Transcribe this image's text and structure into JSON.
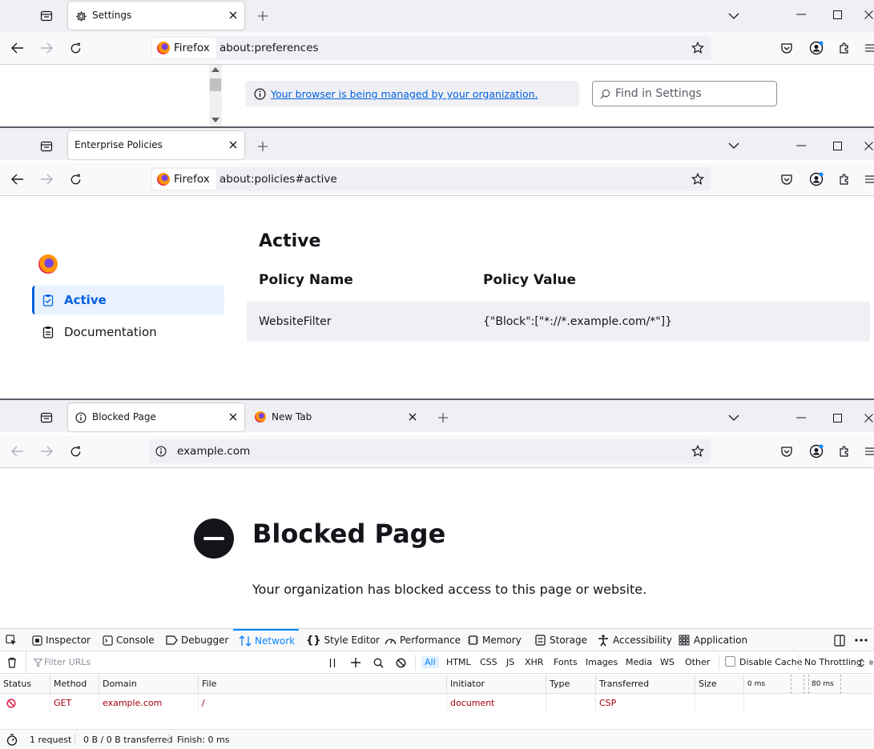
{
  "window1": {
    "tab_title": "Settings",
    "identity_label": "Firefox",
    "url": "about:preferences",
    "managed_notice": "Your browser is being managed by your organization.",
    "search_placeholder": "Find in Settings"
  },
  "window2": {
    "tab_title": "Enterprise Policies",
    "identity_label": "Firefox",
    "url": "about:policies#active",
    "sidebar": [
      {
        "label": "Active",
        "selected": true
      },
      {
        "label": "Documentation",
        "selected": false
      }
    ],
    "heading": "Active",
    "table": {
      "headers": [
        "Policy Name",
        "Policy Value"
      ],
      "rows": [
        [
          "WebsiteFilter",
          "{\"Block\":[\"*://*.example.com/*\"]}"
        ]
      ]
    }
  },
  "window3": {
    "tabs": [
      "Blocked Page",
      "New Tab"
    ],
    "url": "example.com",
    "page_title": "Blocked Page",
    "page_message": "Your organization has blocked access to this page or website."
  },
  "devtools": {
    "tabs": [
      "Inspector",
      "Console",
      "Debugger",
      "Network",
      "Style Editor",
      "Performance",
      "Memory",
      "Storage",
      "Accessibility",
      "Application"
    ],
    "active_tab": "Network",
    "filter_placeholder": "Filter URLs",
    "type_filters": [
      "All",
      "HTML",
      "CSS",
      "JS",
      "XHR",
      "Fonts",
      "Images",
      "Media",
      "WS",
      "Other"
    ],
    "disable_cache_label": "Disable Cache",
    "throttling": "No Throttling",
    "columns": [
      "Status",
      "Method",
      "Domain",
      "File",
      "Initiator",
      "Type",
      "Transferred",
      "Size"
    ],
    "timeline_marks": [
      "0 ms",
      "80 ms"
    ],
    "requests": [
      {
        "method": "GET",
        "domain": "example.com",
        "file": "/",
        "initiator": "document",
        "type": "",
        "transferred": "CSP",
        "size": ""
      }
    ],
    "status_bar": {
      "requests": "1 request",
      "transferred": "0 B / 0 B transferred",
      "finish": "Finish: 0 ms"
    }
  },
  "colors": {
    "accent": "#0061e0",
    "devtools_accent": "#0a84ff",
    "blocked_red": "#a4000f",
    "tabbar_bg": "#f0f0f4"
  }
}
